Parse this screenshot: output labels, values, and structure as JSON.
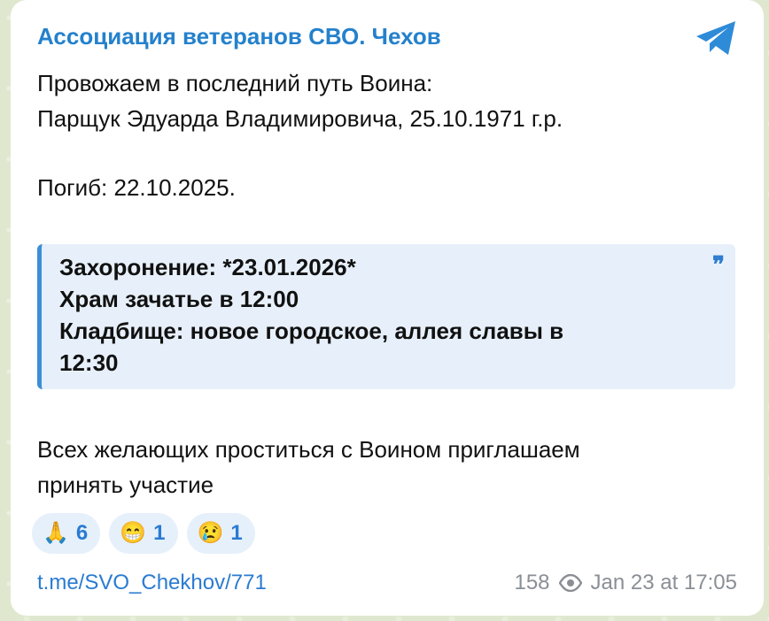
{
  "channel": {
    "title": "Ассоциация ветеранов СВО. Чехов",
    "icon": "telegram-icon"
  },
  "message": {
    "line1": "Провожаем в последний путь Воина:",
    "line2": "Парщук Эдуарда Владимировича, 25.10.1971 г.р.",
    "line3": "Погиб: 22.10.2025.",
    "quote": {
      "line1": "Захоронение: *23.01.2026*",
      "line2": "Храм зачатье в 12:00",
      "line3": "Кладбище: новое городское, аллея славы в",
      "line4": "12:30",
      "icon": "quote-icon"
    },
    "line4": "Всех желающих проститься с Воином приглашаем",
    "line5": "принять участие"
  },
  "reactions": [
    {
      "emoji": "🙏",
      "count": "6"
    },
    {
      "emoji": "😁",
      "count": "1"
    },
    {
      "emoji": "😢",
      "count": "1"
    }
  ],
  "footer": {
    "link": "t.me/SVO_Chekhov/771",
    "views": "158",
    "views_icon": "eye-icon",
    "timestamp": "Jan 23 at 17:05"
  },
  "colors": {
    "accent": "#2481cc",
    "quote_bg": "#e7f0fa",
    "quote_border": "#3a8fd6",
    "reaction_bg": "#e6f0fb",
    "meta": "#8a8f95"
  }
}
